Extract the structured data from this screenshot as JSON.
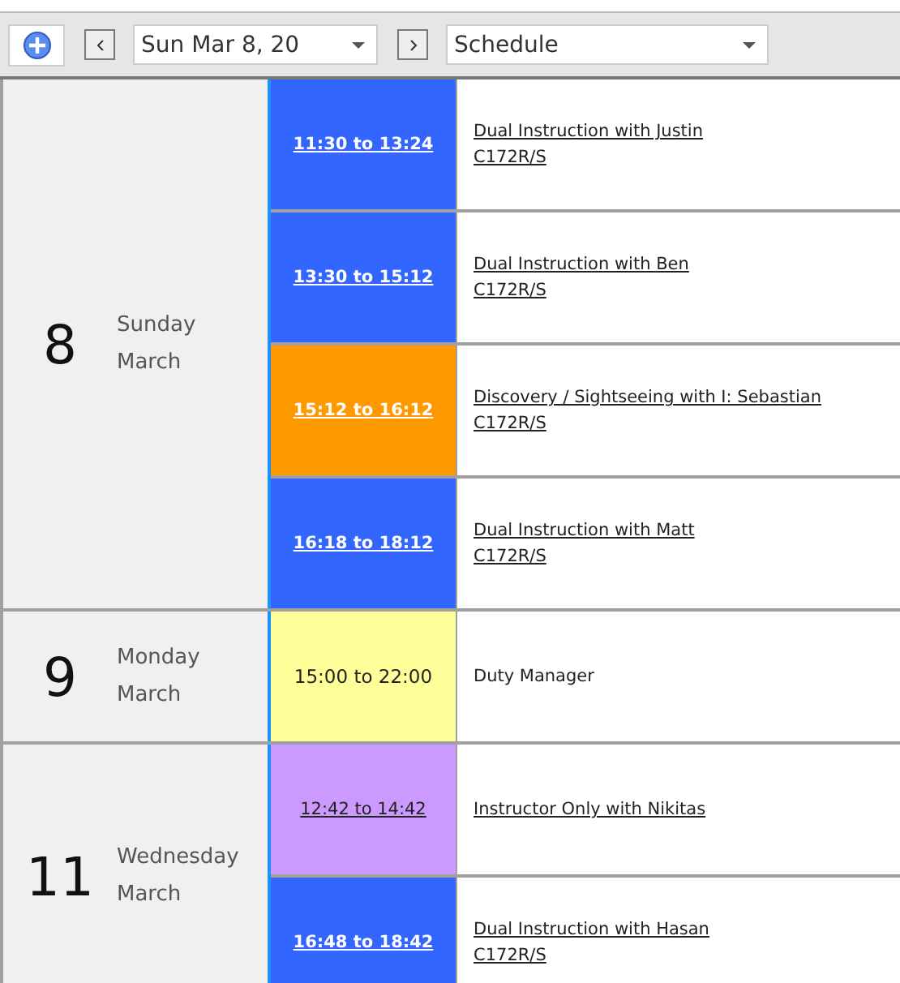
{
  "toolbar": {
    "date": "Sun Mar 8, 20",
    "view": "Schedule"
  },
  "days": [
    {
      "number": "8",
      "weekday": "Sunday",
      "month": "March",
      "events": [
        {
          "kind": "booking",
          "time": "11:30 to 13:24",
          "title": "Dual Instruction with Justin",
          "aircraft": "C172R/S",
          "color": "#3366ff"
        },
        {
          "kind": "booking",
          "time": "13:30 to 15:12",
          "title": "Dual Instruction with Ben",
          "aircraft": "C172R/S",
          "color": "#3366ff"
        },
        {
          "kind": "booking",
          "time": "15:12 to 16:12",
          "title": "Discovery / Sightseeing with I: Sebastian",
          "aircraft": "C172R/S",
          "color": "#ff9900"
        },
        {
          "kind": "booking",
          "time": "16:18 to 18:12",
          "title": "Dual Instruction with Matt",
          "aircraft": "C172R/S",
          "color": "#3366ff"
        }
      ]
    },
    {
      "number": "9",
      "weekday": "Monday",
      "month": "March",
      "events": [
        {
          "kind": "duty",
          "time": "15:00 to 22:00",
          "title": "Duty Manager",
          "color": "#ffff99"
        }
      ]
    },
    {
      "number": "11",
      "weekday": "Wednesday",
      "month": "March",
      "events": [
        {
          "kind": "booking",
          "time": "12:42 to 14:42",
          "title": "Instructor Only with Nikitas",
          "color": "#cc99ff"
        },
        {
          "kind": "booking",
          "time": "16:48 to 18:42",
          "title": "Dual Instruction with Hasan",
          "aircraft": "C172R/S",
          "color": "#3366ff"
        }
      ]
    }
  ]
}
